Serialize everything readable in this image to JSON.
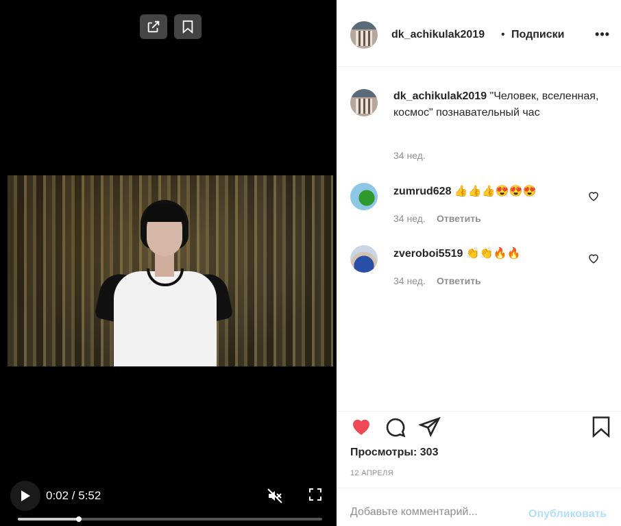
{
  "video": {
    "time": "0:02 / 5:52",
    "progress_fraction": 0.2,
    "share_icon": "share-icon",
    "save_icon": "bookmark-icon",
    "play_icon": "play-icon",
    "mute_icon": "muted-speaker-icon",
    "fullscreen_icon": "fullscreen-icon"
  },
  "header": {
    "username": "dk_achikulak2019",
    "separator": "•",
    "follow_label": "Подписки",
    "more_label": "•••"
  },
  "caption": {
    "username": "dk_achikulak2019",
    "text": "\"Человек, вселенная, космос\" познавательный час",
    "time": "34 нед."
  },
  "comments": [
    {
      "username": "zumrud628",
      "text": "👍👍👍😍😍😍",
      "time": "34 нед.",
      "reply_label": "Ответить"
    },
    {
      "username": "zveroboi5519",
      "text": "👏👏🔥🔥",
      "time": "34 нед.",
      "reply_label": "Ответить"
    }
  ],
  "actions": {
    "liked": true,
    "like_color": "#ed4956",
    "views": "Просмотры: 303",
    "date": "12 АПРЕЛЯ"
  },
  "add_comment": {
    "placeholder": "Добавьте комментарий...",
    "publish_label": "Опубликовать",
    "publish_color": "#b2dffc"
  }
}
